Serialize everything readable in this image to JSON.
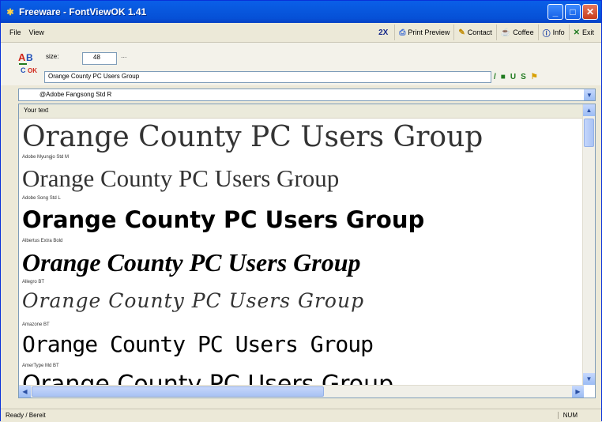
{
  "window": {
    "title": "Freeware - FontViewOK 1.41",
    "title_icon": "star-icon"
  },
  "menu": {
    "items": [
      {
        "label": "File"
      },
      {
        "label": "View"
      }
    ]
  },
  "toolbar": {
    "zoom_label": "2X",
    "print_preview": "Print Preview",
    "contact": "Contact",
    "coffee": "Coffee",
    "info": "Info",
    "exit": "Exit"
  },
  "controls": {
    "size_label": "size:",
    "size_value": "48",
    "size_extra": "...",
    "sample_text": "Orange County PC Users Group"
  },
  "font_dropdown": {
    "selected": "@Adobe Fangsong Std R"
  },
  "preview": {
    "header_label": "Your text",
    "samples": [
      {
        "text": "Orange County PC Users Group",
        "font_label": "Adobe Myungjo Std M"
      },
      {
        "text": "Orange County PC Users Group",
        "font_label": "Adobe Song Std L"
      },
      {
        "text": "Orange County PC Users Group",
        "font_label": "Albertus Extra Bold"
      },
      {
        "text": "Orange County PC Users Group",
        "font_label": "Allegro BT"
      },
      {
        "text": "Orange County PC Users Group",
        "font_label": "Amazone BT"
      },
      {
        "text": "Orange County PC Users Group",
        "font_label": "AmerType Md BT"
      },
      {
        "text": "Orange County PC Users Group",
        "font_label": ""
      }
    ]
  },
  "status": {
    "text": "Ready / Bereit",
    "num": "NUM"
  },
  "colors": {
    "titlebar": "#0858de",
    "window_bg": "#ece9d8",
    "accent_green": "#1f7a1f"
  }
}
